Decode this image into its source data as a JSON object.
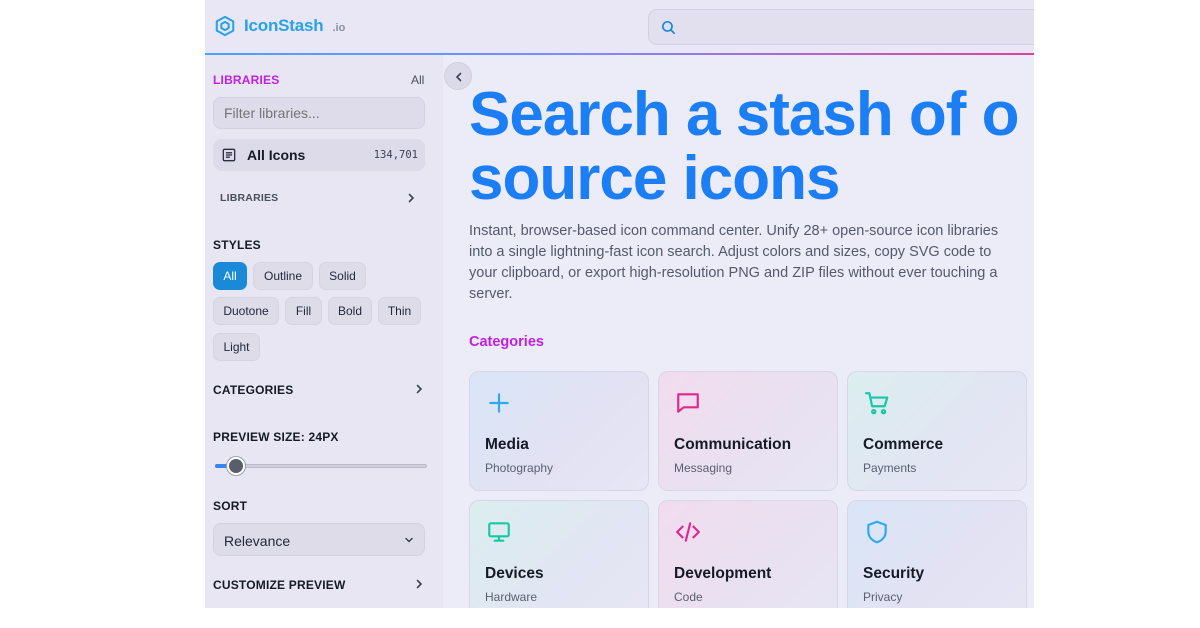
{
  "header": {
    "logo_name": "IconStash",
    "logo_tld": ".io",
    "search_placeholder": ""
  },
  "sidebar": {
    "libraries_heading": "LIBRARIES",
    "libraries_all": "All",
    "filter_placeholder": "Filter libraries...",
    "all_icons_label": "All Icons",
    "all_icons_count": "134,701",
    "libraries_sub": "LIBRARIES",
    "styles_heading": "STYLES",
    "styles": [
      "All",
      "Outline",
      "Solid",
      "Duotone",
      "Fill",
      "Bold",
      "Thin",
      "Light"
    ],
    "active_style": "All",
    "categories_heading": "CATEGORIES",
    "preview_size_heading": "PREVIEW SIZE: 24PX",
    "preview_size_fraction": 0.1,
    "sort_heading": "SORT",
    "sort_value": "Relevance",
    "customize_heading": "CUSTOMIZE PREVIEW"
  },
  "main": {
    "hero_line1": "Search a stash of o",
    "hero_line2": "source icons",
    "hero_desc": "Instant, browser-based icon command center. Unify 28+ open-source icon libraries into a single lightning-fast icon search. Adjust colors and sizes, copy SVG code to your clipboard, or export high-resolution PNG and ZIP files without ever touching a server.",
    "categories_title": "Categories",
    "categories": [
      {
        "title": "Media",
        "sub": "Photography",
        "icon": "plus-icon",
        "color": "#2ea8f0"
      },
      {
        "title": "Communication",
        "sub": "Messaging",
        "icon": "message-square-icon",
        "color": "#e0288a"
      },
      {
        "title": "Commerce",
        "sub": "Payments",
        "icon": "shopping-cart-icon",
        "color": "#16c9a4"
      },
      {
        "title": "Devices",
        "sub": "Hardware",
        "icon": "monitor-icon",
        "color": "#16c9a4"
      },
      {
        "title": "Development",
        "sub": "Code",
        "icon": "code-icon",
        "color": "#e0288a"
      },
      {
        "title": "Security",
        "sub": "Privacy",
        "icon": "shield-icon",
        "color": "#2ea8f0"
      }
    ]
  },
  "colors": {
    "brand_blue": "#1b7ef5",
    "accent_magenta": "#c020e0",
    "active_pill": "#1a8ad8"
  }
}
